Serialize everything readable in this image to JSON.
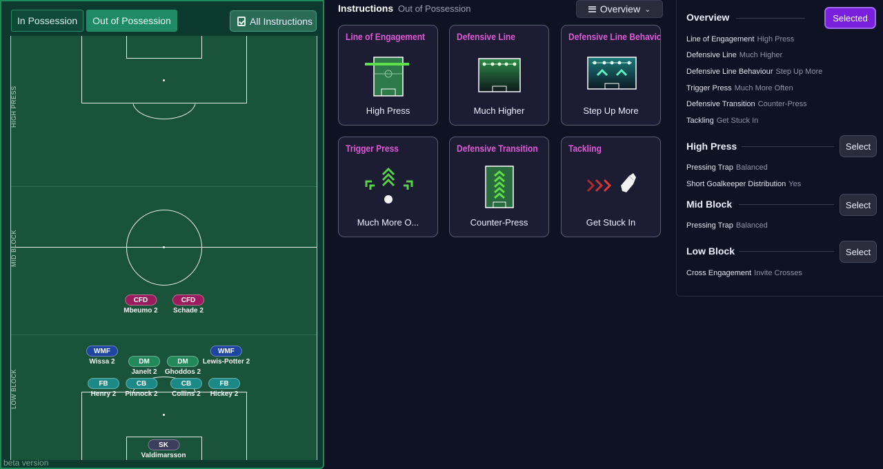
{
  "tabs": [
    "In Possession",
    "Out of Possession"
  ],
  "all_instructions": "All Instructions",
  "zones": [
    "HIGH PRESS",
    "MID BLOCK",
    "LOW BLOCK"
  ],
  "players": [
    {
      "pos": "CFD",
      "name": "Mbeumo 2"
    },
    {
      "pos": "CFD",
      "name": "Schade 2"
    },
    {
      "pos": "WMF",
      "name": "Wissa 2"
    },
    {
      "pos": "WMF",
      "name": "Lewis-Potter 2"
    },
    {
      "pos": "DM",
      "name": "Janelt 2"
    },
    {
      "pos": "DM",
      "name": "Ghoddos 2"
    },
    {
      "pos": "FB",
      "name": "Henry 2"
    },
    {
      "pos": "CB",
      "name": "Pinnock 2"
    },
    {
      "pos": "CB",
      "name": "Collins 2"
    },
    {
      "pos": "FB",
      "name": "Hickey 2"
    },
    {
      "pos": "SK",
      "name": "Valdimarsson"
    }
  ],
  "beta": "beta version",
  "instructions_title": "Instructions",
  "instructions_sub": "Out of Possession",
  "overview_btn": "Overview",
  "cards": [
    {
      "title": "Line of Engagement",
      "value": "High Press"
    },
    {
      "title": "Defensive Line",
      "value": "Much Higher"
    },
    {
      "title": "Defensive Line Behavio",
      "value": "Step Up More"
    },
    {
      "title": "Trigger Press",
      "value": "Much More O..."
    },
    {
      "title": "Defensive Transition",
      "value": "Counter-Press"
    },
    {
      "title": "Tackling",
      "value": "Get Stuck In"
    }
  ],
  "overview": {
    "title": "Overview",
    "btn": "Selected",
    "rows": [
      {
        "k": "Line of Engagement",
        "v": "High Press"
      },
      {
        "k": "Defensive Line",
        "v": "Much Higher"
      },
      {
        "k": "Defensive Line Behaviour",
        "v": "Step Up More"
      },
      {
        "k": "Trigger Press",
        "v": "Much More Often"
      },
      {
        "k": "Defensive Transition",
        "v": "Counter-Press"
      },
      {
        "k": "Tackling",
        "v": "Get Stuck In"
      }
    ]
  },
  "high_press": {
    "title": "High Press",
    "btn": "Select",
    "rows": [
      {
        "k": "Pressing Trap",
        "v": "Balanced"
      },
      {
        "k": "Short Goalkeeper Distribution",
        "v": "Yes"
      }
    ]
  },
  "mid_block": {
    "title": "Mid Block",
    "btn": "Select",
    "rows": [
      {
        "k": "Pressing Trap",
        "v": "Balanced"
      }
    ]
  },
  "low_block": {
    "title": "Low Block",
    "btn": "Select",
    "rows": [
      {
        "k": "Cross Engagement",
        "v": "Invite Crosses"
      }
    ]
  },
  "colors": {
    "accent": "#7a1fdb",
    "card_title": "#e05ad9",
    "pitch": "#19543a",
    "cfd": "#9b1c5e",
    "wmf": "#1e45a0",
    "dm": "#22895a",
    "cb": "#1b8a86",
    "sk": "#3d3d5e"
  }
}
